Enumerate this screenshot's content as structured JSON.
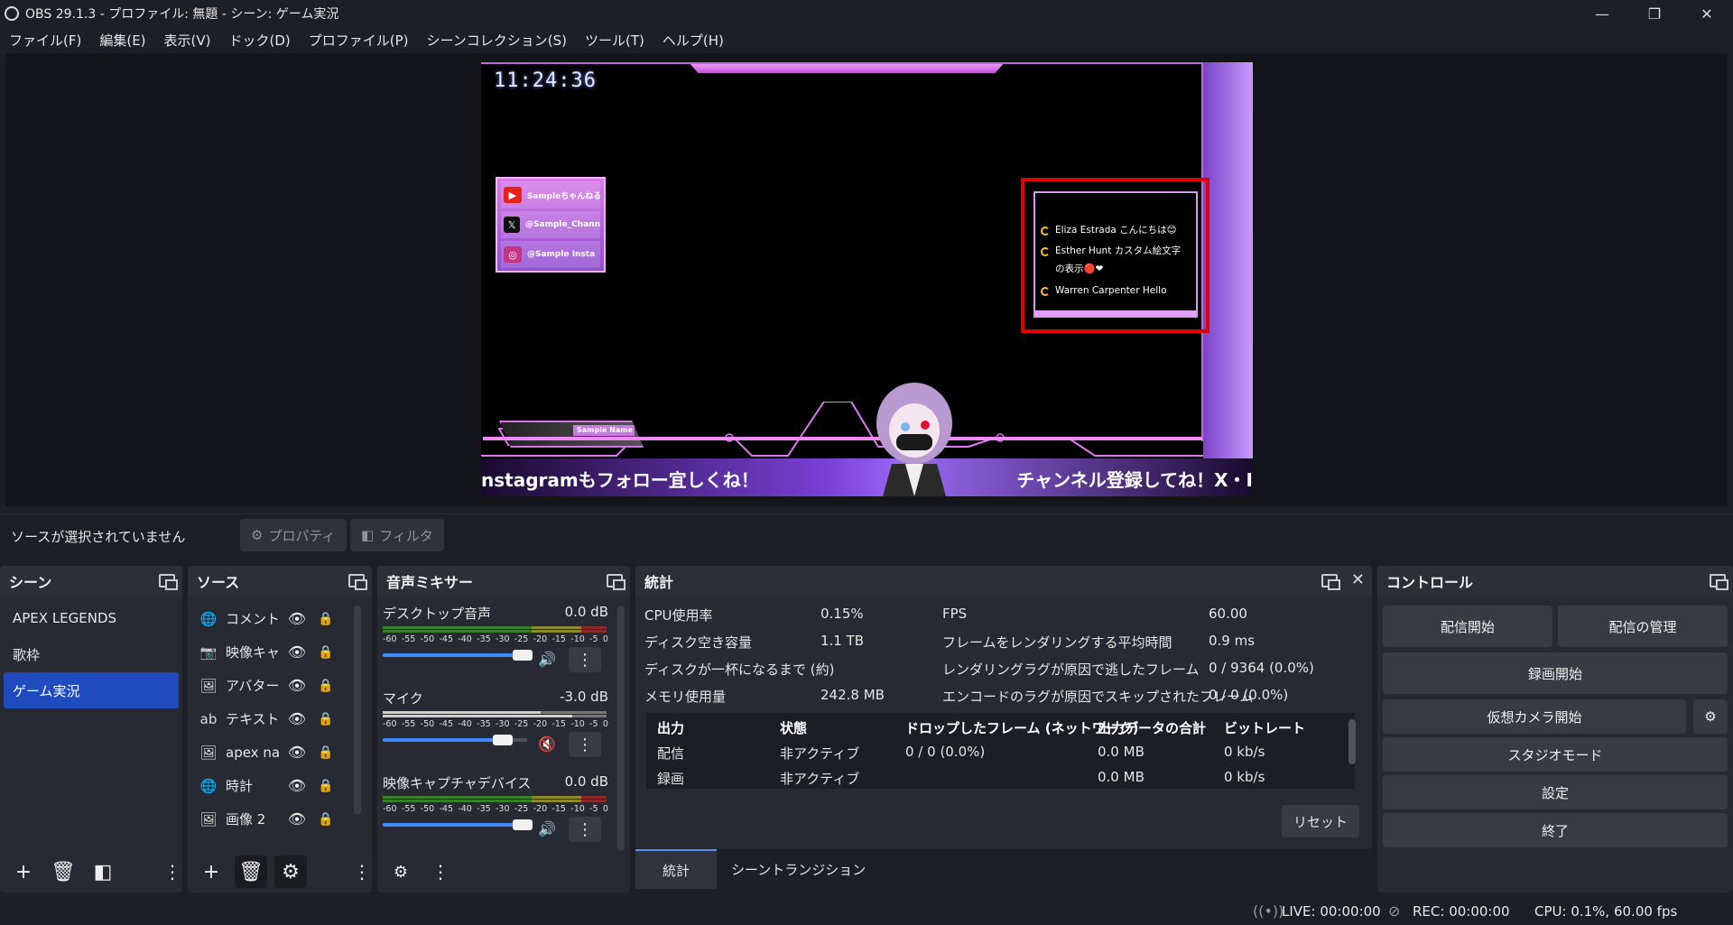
{
  "window": {
    "title": "OBS 29.1.3 - プロファイル: 無題 - シーン: ゲーム実況",
    "minimize": "—",
    "restore": "❐",
    "close": "✕"
  },
  "menu": [
    "ファイル(F)",
    "編集(E)",
    "表示(V)",
    "ドック(D)",
    "プロファイル(P)",
    "シーンコレクション(S)",
    "ツール(T)",
    "ヘルプ(H)"
  ],
  "preview": {
    "clock": "11:24:36",
    "social": [
      {
        "icon": "youtube-icon",
        "glyph": "▶",
        "color": "#e62117",
        "text": "Sampleちゃんねる"
      },
      {
        "icon": "x-icon",
        "glyph": "𝕏",
        "color": "#111111",
        "text": "@Sample_Channel"
      },
      {
        "icon": "instagram-icon",
        "glyph": "◎",
        "color": "#c13584",
        "text": "@Sample Insta"
      }
    ],
    "chat": [
      {
        "text": "Eliza Estrada こんにちは😊"
      },
      {
        "text": "Esther Hunt カスタム絵文字"
      },
      {
        "text": "の表示🔴❤"
      },
      {
        "text": "Warren Carpenter Hello"
      }
    ],
    "name_plate": "Sample Name",
    "ticker_left": "nstagramもフォロー宜しくね！",
    "ticker_right": "チャンネル登録してね！X・I"
  },
  "source_bar": {
    "no_source": "ソースが選択されていません",
    "properties": "プロパティ",
    "filters": "フィルタ"
  },
  "scenes": {
    "title": "シーン",
    "items": [
      {
        "label": "APEX LEGENDS",
        "selected": false
      },
      {
        "label": "歌枠",
        "selected": false
      },
      {
        "label": "ゲーム実況",
        "selected": true
      }
    ]
  },
  "sources": {
    "title": "ソース",
    "items": [
      {
        "icon": "globe-icon",
        "glyph": "🌐",
        "label": "コメント欄"
      },
      {
        "icon": "camera-icon",
        "glyph": "📷",
        "label": "映像キャプチャ"
      },
      {
        "icon": "image-icon",
        "glyph": "🖼",
        "label": "アバター"
      },
      {
        "icon": "text-icon",
        "glyph": "ab",
        "label": "テキスト ("
      },
      {
        "icon": "image-icon",
        "glyph": "🖼",
        "label": "apex name"
      },
      {
        "icon": "globe-icon",
        "glyph": "🌐",
        "label": "時計"
      },
      {
        "icon": "image-icon",
        "glyph": "🖼",
        "label": "画像 2"
      }
    ]
  },
  "mixer": {
    "title": "音声ミキサー",
    "ticks": [
      "-60",
      "-55",
      "-50",
      "-45",
      "-40",
      "-35",
      "-30",
      "-25",
      "-20",
      "-15",
      "-10",
      "-5",
      "0"
    ],
    "channels": [
      {
        "name": "デスクトップ音声",
        "db": "0.0 dB",
        "volume": 1.0,
        "muted": false
      },
      {
        "name": "マイク",
        "db": "-3.0 dB",
        "volume": 0.85,
        "muted": true
      },
      {
        "name": "映像キャプチャデバイス",
        "db": "0.0 dB",
        "volume": 1.0,
        "muted": false
      }
    ]
  },
  "stats": {
    "title": "統計",
    "left": [
      {
        "label": "CPU使用率",
        "value": "0.15%"
      },
      {
        "label": "ディスク空き容量",
        "value": "1.1 TB"
      },
      {
        "label": "ディスクが一杯になるまで (約)",
        "value": ""
      },
      {
        "label": "メモリ使用量",
        "value": "242.8 MB"
      }
    ],
    "right": [
      {
        "label": "FPS",
        "value": "60.00"
      },
      {
        "label": "フレームをレンダリングする平均時間",
        "value": "0.9 ms"
      },
      {
        "label": "レンダリングラグが原因で逃したフレーム",
        "value": "0 / 9364 (0.0%)"
      },
      {
        "label": "エンコードのラグが原因でスキップされたフレーム",
        "value": "0 / 0 (0.0%)"
      }
    ],
    "table_headers": [
      "出力",
      "状態",
      "ドロップしたフレーム (ネットワーク)",
      "出力データの合計",
      "ビットレート"
    ],
    "table_rows": [
      [
        "配信",
        "非アクティブ",
        "0 / 0 (0.0%)",
        "0.0 MB",
        "0 kb/s"
      ],
      [
        "録画",
        "非アクティブ",
        "",
        "0.0 MB",
        "0 kb/s"
      ]
    ],
    "reset": "リセット"
  },
  "tabs": [
    "統計",
    "シーントランジション"
  ],
  "controls": {
    "title": "コントロール",
    "start_stream": "配信開始",
    "manage_stream": "配信の管理",
    "start_record": "録画開始",
    "virtual_cam": "仮想カメラ開始",
    "studio_mode": "スタジオモード",
    "settings": "設定",
    "exit": "終了"
  },
  "status": {
    "live": "LIVE: 00:00:00",
    "rec": "REC: 00:00:00",
    "cpu": "CPU: 0.1%, 60.00 fps"
  }
}
